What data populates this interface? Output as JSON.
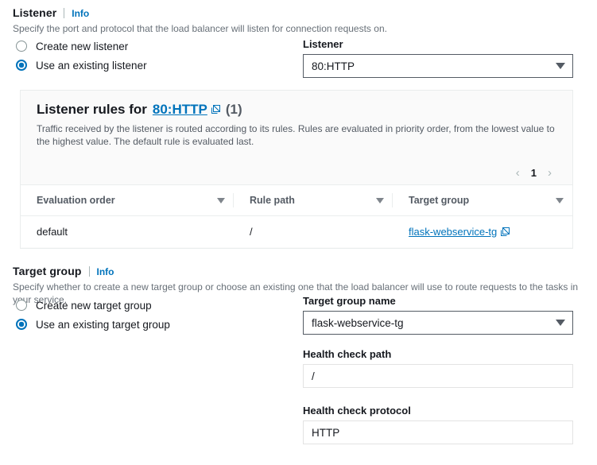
{
  "listener_section": {
    "title": "Listener",
    "info_label": "Info",
    "description": "Specify the port and protocol that the load balancer will listen for connection requests on.",
    "radio_options": [
      {
        "label": "Create new listener",
        "selected": false
      },
      {
        "label": "Use an existing listener",
        "selected": true
      }
    ],
    "field": {
      "label": "Listener",
      "value": "80:HTTP",
      "type": "select"
    }
  },
  "rules_panel": {
    "title_prefix": "Listener rules for",
    "title_link": "80:HTTP",
    "count": "(1)",
    "description": "Traffic received by the listener is routed according to its rules. Rules are evaluated in priority order, from the lowest value to the highest value. The default rule is evaluated last.",
    "pagination": {
      "prev": "‹",
      "page": "1",
      "next": "›"
    },
    "table": {
      "columns": [
        "Evaluation order",
        "Rule path",
        "Target group"
      ],
      "rows": [
        {
          "evaluation_order": "default",
          "rule_path": "/",
          "target_group": "flask-webservice-tg"
        }
      ]
    }
  },
  "target_group_section": {
    "title": "Target group",
    "info_label": "Info",
    "description": "Specify whether to create a new target group or choose an existing one that the load balancer will use to route requests to the tasks in your service.",
    "radio_options": [
      {
        "label": "Create new target group",
        "selected": false
      },
      {
        "label": "Use an existing target group",
        "selected": true
      }
    ],
    "fields": {
      "target_group_name": {
        "label": "Target group name",
        "value": "flask-webservice-tg",
        "type": "select"
      },
      "health_check_path": {
        "label": "Health check path",
        "value": "/",
        "type": "readonly-text"
      },
      "health_check_protocol": {
        "label": "Health check protocol",
        "value": "HTTP",
        "type": "readonly-text"
      }
    }
  },
  "colors": {
    "accent_blue": "#0073bb",
    "text_primary": "#16191f",
    "text_secondary": "#545b64",
    "text_muted": "#687078",
    "border": "#eaeded",
    "input_border": "#545b64",
    "panel_bg": "#fafafa"
  }
}
